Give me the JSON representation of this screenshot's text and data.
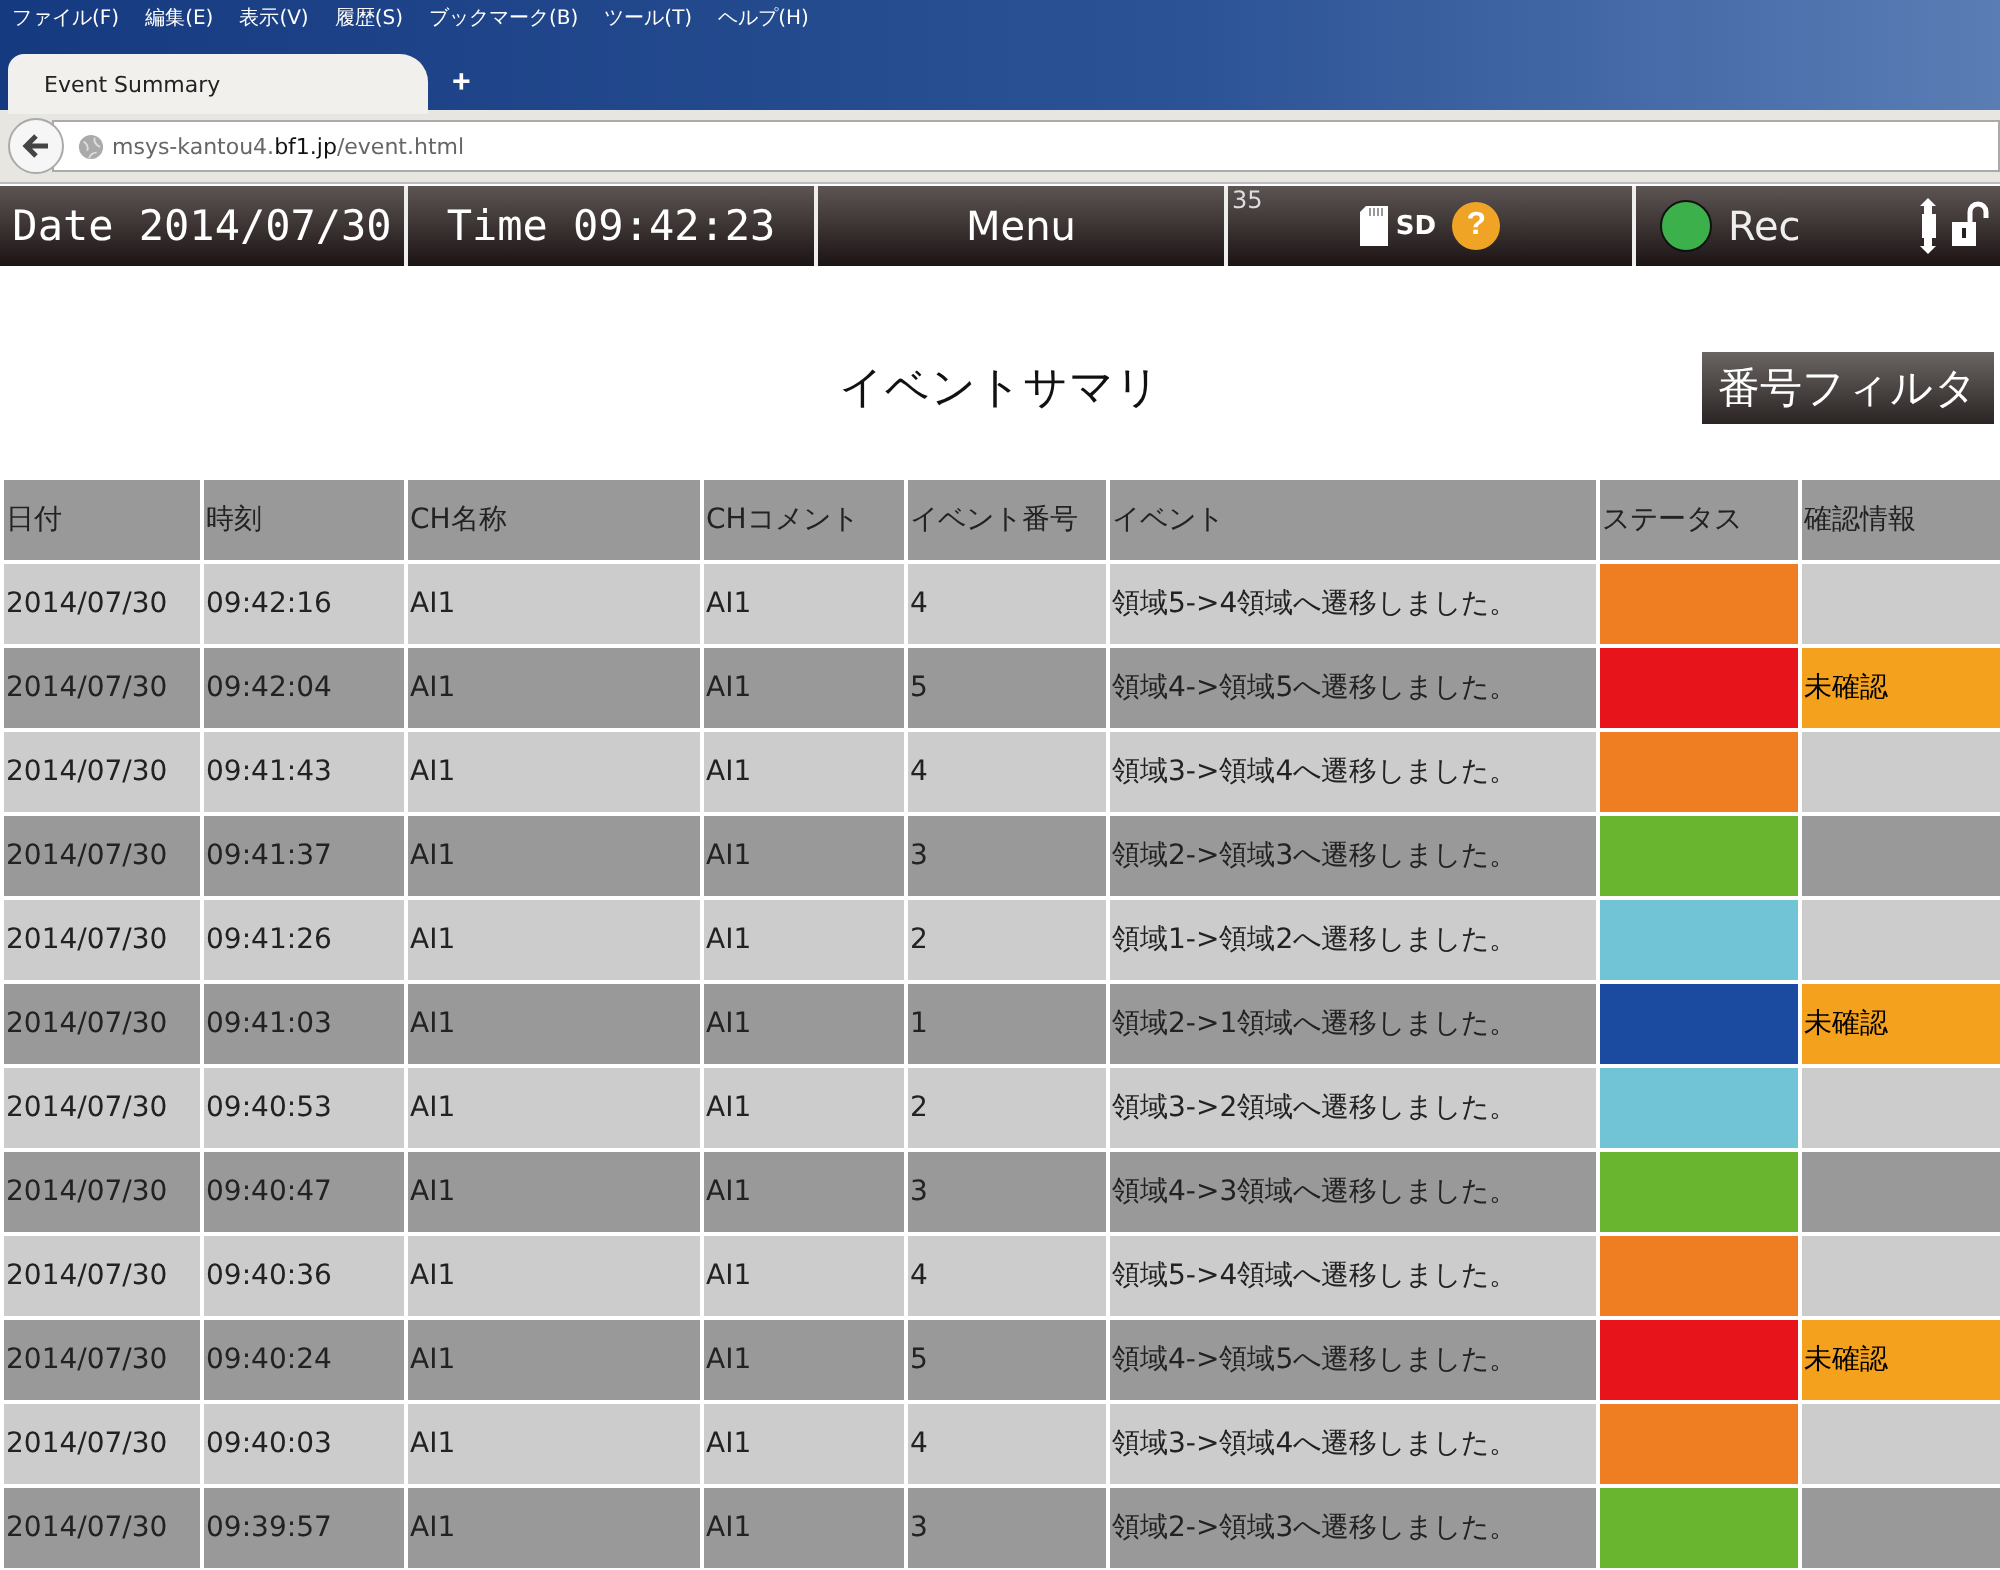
{
  "browser": {
    "menu": [
      "ファイル(F)",
      "編集(E)",
      "表示(V)",
      "履歴(S)",
      "ブックマーク(B)",
      "ツール(T)",
      "ヘルプ(H)"
    ],
    "tabs": [
      {
        "label": "Event Summary",
        "selected": true
      }
    ],
    "new_tab": "+",
    "url_host_prefix": "msys-kantou4.",
    "url_host": "bf1.jp",
    "url_path": "/event.html"
  },
  "app_bar": {
    "date": "Date 2014/07/30",
    "time": "Time 09:42:23",
    "menu": "Menu",
    "counter": "35",
    "sd": "SD",
    "help": "?",
    "rec_on": true,
    "rec": "Rec"
  },
  "title": "イベントサマリ",
  "filter_button": "番号フィルタ",
  "table": {
    "columns": [
      "日付",
      "時刻",
      "CH名称",
      "CHコメント",
      "イベント番号",
      "イベント",
      "ステータス",
      "確認情報"
    ],
    "rows": [
      {
        "date": "2014/07/30",
        "time": "09:42:16",
        "ch": "AI1",
        "comment": "AI1",
        "number": "4",
        "event": "領域5->4領域へ遷移しました。",
        "color": "#ef7d22"
      },
      {
        "date": "2014/07/30",
        "time": "09:42:04",
        "ch": "AI1",
        "comment": "AI1",
        "number": "5",
        "event": "領域4->領域5へ遷移しました。",
        "color": "#e8141c",
        "confirm": "未確認"
      },
      {
        "date": "2014/07/30",
        "time": "09:41:43",
        "ch": "AI1",
        "comment": "AI1",
        "number": "4",
        "event": "領域3->領域4へ遷移しました。",
        "color": "#ef7d22"
      },
      {
        "date": "2014/07/30",
        "time": "09:41:37",
        "ch": "AI1",
        "comment": "AI1",
        "number": "3",
        "event": "領域2->領域3へ遷移しました。",
        "color": "#69b52f"
      },
      {
        "date": "2014/07/30",
        "time": "09:41:26",
        "ch": "AI1",
        "comment": "AI1",
        "number": "2",
        "event": "領域1->領域2へ遷移しました。",
        "color": "#70c4d6"
      },
      {
        "date": "2014/07/30",
        "time": "09:41:03",
        "ch": "AI1",
        "comment": "AI1",
        "number": "1",
        "event": "領域2->1領域へ遷移しました。",
        "color": "#1b4ba0",
        "confirm": "未確認"
      },
      {
        "date": "2014/07/30",
        "time": "09:40:53",
        "ch": "AI1",
        "comment": "AI1",
        "number": "2",
        "event": "領域3->2領域へ遷移しました。",
        "color": "#70c4d6"
      },
      {
        "date": "2014/07/30",
        "time": "09:40:47",
        "ch": "AI1",
        "comment": "AI1",
        "number": "3",
        "event": "領域4->3領域へ遷移しました。",
        "color": "#69b52f"
      },
      {
        "date": "2014/07/30",
        "time": "09:40:36",
        "ch": "AI1",
        "comment": "AI1",
        "number": "4",
        "event": "領域5->4領域へ遷移しました。",
        "color": "#ef7d22"
      },
      {
        "date": "2014/07/30",
        "time": "09:40:24",
        "ch": "AI1",
        "comment": "AI1",
        "number": "5",
        "event": "領域4->領域5へ遷移しました。",
        "color": "#e8141c",
        "confirm": "未確認"
      },
      {
        "date": "2014/07/30",
        "time": "09:40:03",
        "ch": "AI1",
        "comment": "AI1",
        "number": "4",
        "event": "領域3->領域4へ遷移しました。",
        "color": "#ef7d22"
      },
      {
        "date": "2014/07/30",
        "time": "09:39:57",
        "ch": "AI1",
        "comment": "AI1",
        "number": "3",
        "event": "領域2->領域3へ遷移しました。",
        "color": "#69b52f"
      }
    ]
  }
}
